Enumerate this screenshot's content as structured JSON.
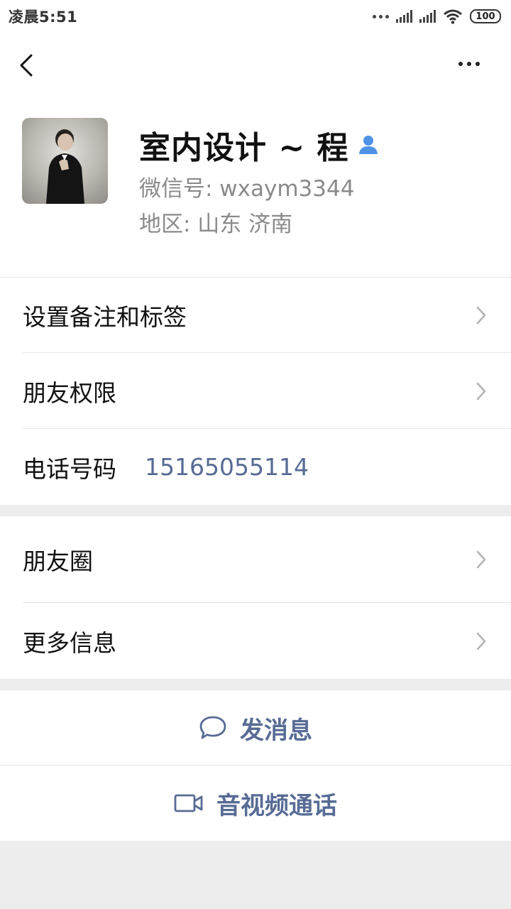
{
  "status": {
    "time": "凌晨5:51",
    "battery": "100"
  },
  "profile": {
    "name": "室内设计 ~ 程",
    "wechat_id": "微信号:  wxaym3344",
    "region": "地区:  山东  济南"
  },
  "menu": {
    "remark_tags": "设置备注和标签",
    "friend_permissions": "朋友权限",
    "phone_label": "电话号码",
    "phone_value": "15165055114",
    "moments": "朋友圈",
    "more_info": "更多信息"
  },
  "actions": {
    "send_message": "发消息",
    "av_call": "音视频通话"
  },
  "colors": {
    "link": "#576b95",
    "background": "#ededed"
  }
}
